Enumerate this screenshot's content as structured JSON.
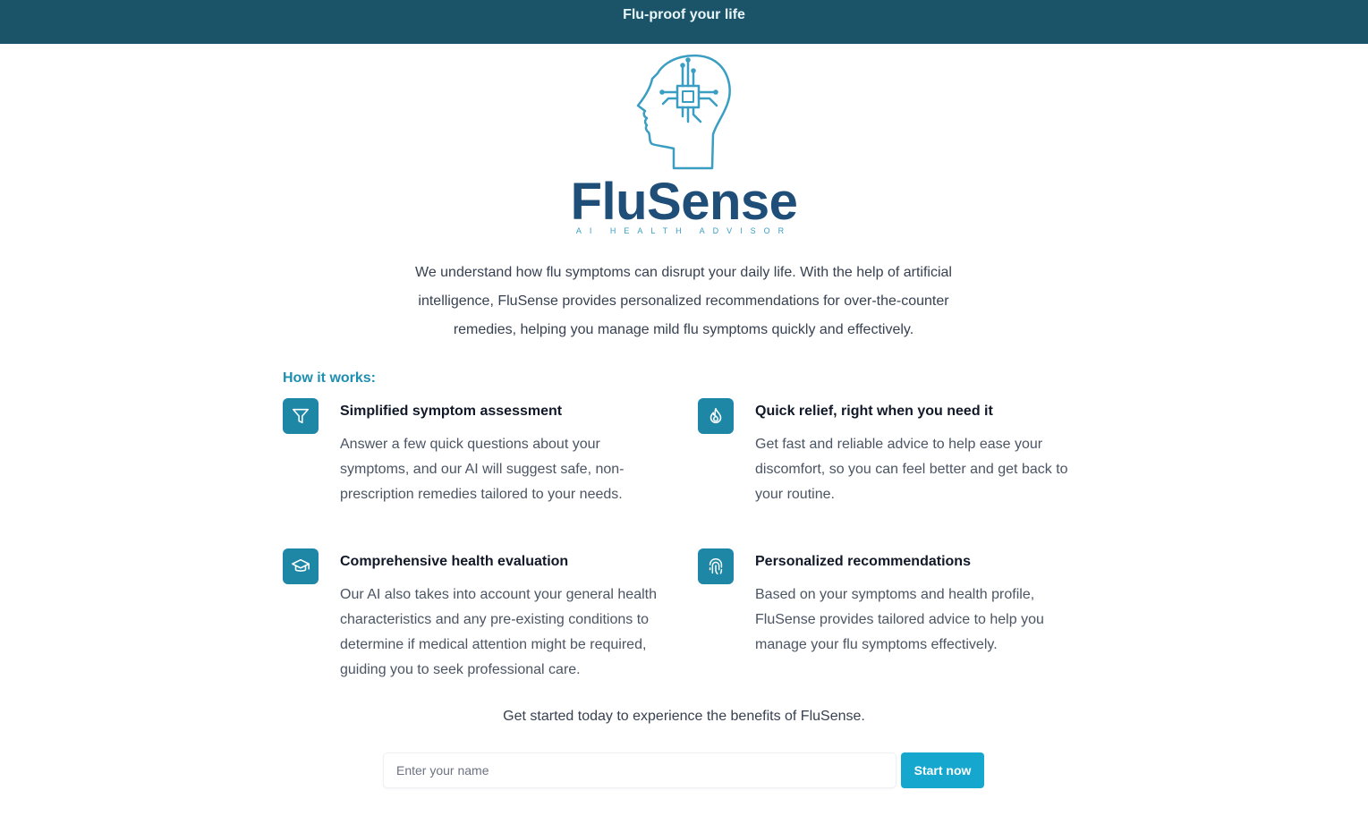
{
  "banner": {
    "text": "Flu-proof your life"
  },
  "logo": {
    "icon": "brain-chip-head-logo",
    "name": "FluSense",
    "tagline": "AI HEALTH ADVISOR"
  },
  "intro": {
    "text": "We understand how flu symptoms can disrupt your daily life. With the help of artificial intelligence, FluSense provides personalized recommendations for over-the-counter remedies, helping you manage mild flu symptoms quickly and effectively."
  },
  "how_it_works": {
    "title": "How it works:",
    "features": [
      {
        "icon": "funnel-icon",
        "title": "Simplified symptom assessment",
        "description": "Answer a few quick questions about your symptoms, and our AI will suggest safe, non-prescription remedies tailored to your needs."
      },
      {
        "icon": "flame-icon",
        "title": "Quick relief, right when you need it",
        "description": "Get fast and reliable advice to help ease your discomfort, so you can feel better and get back to your routine."
      },
      {
        "icon": "graduation-cap-icon",
        "title": "Comprehensive health evaluation",
        "description": "Our AI also takes into account your general health characteristics and any pre-existing conditions to determine if medical attention might be required, guiding you to seek professional care."
      },
      {
        "icon": "fingerprint-icon",
        "title": "Personalized recommendations",
        "description": "Based on your symptoms and health profile, FluSense provides tailored advice to help you manage your flu symptoms effectively."
      }
    ]
  },
  "cta": {
    "text": "Get started today to experience the benefits of FluSense.",
    "input_placeholder": "Enter your name",
    "input_value": "",
    "button_label": "Start now"
  },
  "colors": {
    "banner_bg": "#1b5468",
    "accent": "#1e8fb0",
    "icon_bg": "#1e87a6",
    "button_bg": "#16a7cf",
    "logo_navy": "#1f4e79",
    "logo_cyan": "#3a9ec2"
  }
}
